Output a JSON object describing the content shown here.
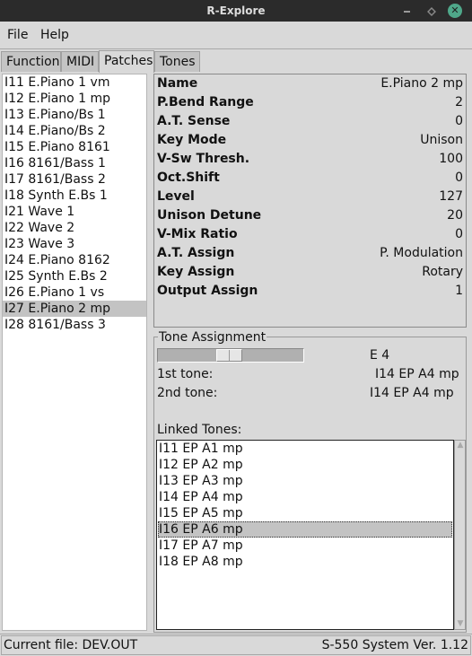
{
  "window": {
    "title": "R-Explore"
  },
  "menu": {
    "file": "File",
    "help": "Help"
  },
  "tabs": [
    {
      "label": "Function",
      "active": false
    },
    {
      "label": "MIDI",
      "active": false
    },
    {
      "label": "Patches",
      "active": true
    },
    {
      "label": "Tones",
      "active": false
    }
  ],
  "patches": {
    "items": [
      "I11 E.Piano 1 vm",
      "I12 E.Piano 1 mp",
      "I13 E.Piano/Bs 1",
      "I14 E.Piano/Bs 2",
      "I15 E.Piano 8161",
      "I16 8161/Bass 1",
      "I17 8161/Bass 2",
      "I18 Synth E.Bs 1",
      "I21 Wave 1",
      "I22 Wave 2",
      "I23 Wave 3",
      "I24 E.Piano 8162",
      "I25 Synth E.Bs 2",
      "I26 E.Piano 1 vs",
      "I27 E.Piano 2 mp",
      "I28 8161/Bass 3"
    ],
    "selected_index": 14
  },
  "params": [
    {
      "label": "Name",
      "value": "E.Piano 2 mp"
    },
    {
      "label": "P.Bend Range",
      "value": "2"
    },
    {
      "label": "A.T. Sense",
      "value": "0"
    },
    {
      "label": "Key Mode",
      "value": "Unison"
    },
    {
      "label": "V-Sw Thresh.",
      "value": "100"
    },
    {
      "label": "Oct.Shift",
      "value": "0"
    },
    {
      "label": "Level",
      "value": "127"
    },
    {
      "label": "Unison Detune",
      "value": "20"
    },
    {
      "label": "V-Mix Ratio",
      "value": "0"
    },
    {
      "label": "A.T. Assign",
      "value": "P. Modulation"
    },
    {
      "label": "Key Assign",
      "value": "Rotary"
    },
    {
      "label": "Output Assign",
      "value": "1"
    }
  ],
  "tone_assignment": {
    "title": "Tone Assignment",
    "slider_fraction": 0.49,
    "note": "E 4",
    "first_tone_label": "1st tone:",
    "first_tone_value": "I14 EP A4 mp",
    "second_tone_label": "2nd tone:",
    "second_tone_value": "I14 EP A4 mp",
    "linked_label": "Linked Tones:",
    "linked_tones": [
      "I11 EP A1 mp",
      "I12 EP A2 mp",
      "I13 EP A3 mp",
      "I14 EP A4 mp",
      "I15 EP A5 mp",
      "I16 EP A6 mp",
      "I17 EP A7 mp",
      "I18 EP A8 mp"
    ],
    "linked_selected_index": 5
  },
  "status": {
    "current_file": "Current file: DEV.OUT",
    "version": "S-550 System Ver. 1.12"
  }
}
